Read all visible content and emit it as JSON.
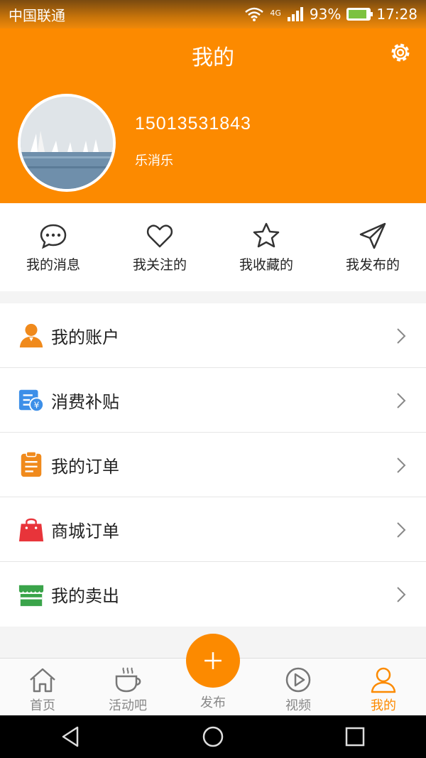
{
  "status_bar": {
    "carrier": "中国联通",
    "network": "4G",
    "battery": "93%",
    "time": "17:28"
  },
  "header": {
    "title": "我的",
    "phone": "15013531843",
    "nickname": "乐消乐"
  },
  "quick_actions": [
    {
      "label": "我的消息",
      "icon": "message-icon"
    },
    {
      "label": "我关注的",
      "icon": "heart-icon"
    },
    {
      "label": "我收藏的",
      "icon": "star-icon"
    },
    {
      "label": "我发布的",
      "icon": "send-icon"
    }
  ],
  "menu": [
    {
      "label": "我的账户",
      "icon": "user-icon",
      "color": "#f08a1c"
    },
    {
      "label": "消费补贴",
      "icon": "subsidy-icon",
      "color": "#3d8fe8"
    },
    {
      "label": "我的订单",
      "icon": "clipboard-icon",
      "color": "#f08a1c"
    },
    {
      "label": "商城订单",
      "icon": "shopping-bag-icon",
      "color": "#e8343a"
    },
    {
      "label": "我的卖出",
      "icon": "shop-icon",
      "color": "#3aa44a"
    }
  ],
  "tabs": [
    {
      "label": "首页",
      "icon": "home-icon"
    },
    {
      "label": "活动吧",
      "icon": "coffee-icon"
    },
    {
      "label": "发布",
      "icon": "plus-icon"
    },
    {
      "label": "视频",
      "icon": "play-icon"
    },
    {
      "label": "我的",
      "icon": "person-icon"
    }
  ],
  "colors": {
    "accent": "#fc8a00",
    "text": "#222222",
    "inactive": "#888888"
  }
}
